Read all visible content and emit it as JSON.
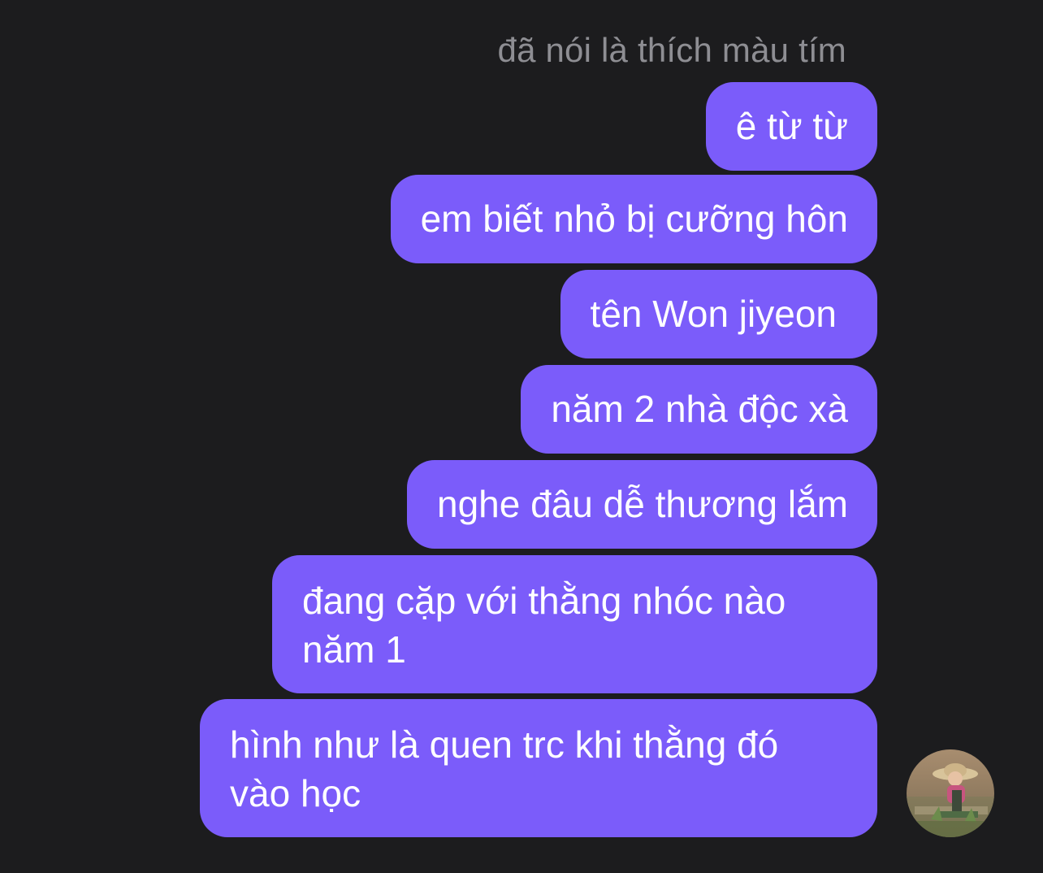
{
  "previous_message": "đã nói là thích màu tím",
  "messages": [
    {
      "text": "ê từ từ"
    },
    {
      "text": "em biết nhỏ bị cưỡng hôn"
    },
    {
      "text": "tên Won jiyeon"
    },
    {
      "text": "năm 2 nhà độc xà"
    },
    {
      "text": "nghe đâu dễ thương lắm"
    },
    {
      "text": "đang cặp với thằng nhóc nào năm 1"
    },
    {
      "text": "hình như là quen trc khi thằng đó vào học"
    }
  ],
  "colors": {
    "background": "#1c1c1e",
    "bubble": "#7b5cfa",
    "bubble_text": "#ffffff",
    "secondary_text": "#8e8e93"
  },
  "avatar": {
    "icon": "user-avatar-photo"
  }
}
